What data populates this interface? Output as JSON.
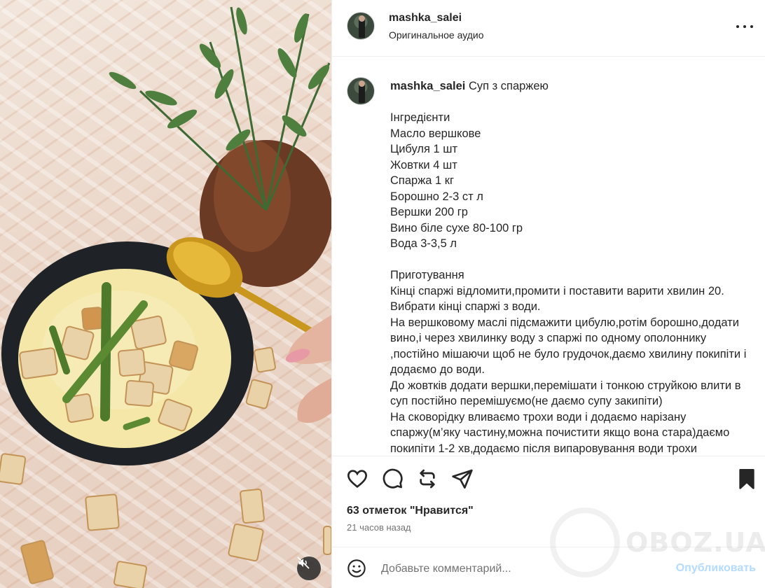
{
  "post": {
    "username": "mashka_salei",
    "audio": "Оригинальное аудио"
  },
  "caption": {
    "username": "mashka_salei",
    "title": "Суп з спаржею",
    "body": "Інгредієнти\nМасло вершкове\nЦибуля 1 шт\nЖовтки 4 шт\nСпаржа 1 кг\nБорошно 2-3 ст л\nВершки 200 гр\nВино біле сухе 80-100 гр\nВода 3-3,5 л\n\nПриготування\nКінці спаржі відломити,промити і поставити варити хвилин 20.\nВибрати кінці спаржі з води.\nНа вершковому маслі підсмажити цибулю,ротім борошно,додати вино,і через хвилинку воду з спаржі по одному ополоннику ,постійно мішаючи щоб не було грудочок,даємо хвилину покипіти і додаємо до води.\nДо жовтків додати вершки,перемішати і тонкою струйкою влити в суп постійно перемішуємо(не даємо супу закипіти)\nНа сковорідку вливаємо трохи води і додаємо нарізану спаржу(м’яку частину,можна почистити якщо вона стара)даємо покипіти 1-2 хв,додаємо після випаровування води трохи"
  },
  "stats": {
    "likes": "63 отметок \"Нравится\"",
    "time": "21 часов назад"
  },
  "comment": {
    "placeholder": "Добавьте комментарий...",
    "publish": "Опубликовать"
  },
  "watermark": "OBOZ.UA",
  "icons": {
    "like": "heart-icon",
    "comment": "comment-bubble-icon",
    "repost": "repost-icon",
    "share": "send-icon",
    "save": "bookmark-icon",
    "more": "more-dots-icon",
    "emoji": "emoji-smile-icon",
    "mute": "speaker-muted-icon"
  },
  "colors": {
    "text": "#262626",
    "secondary": "#737373",
    "publish_disabled": "#b3dbff",
    "divider": "#efefef"
  }
}
